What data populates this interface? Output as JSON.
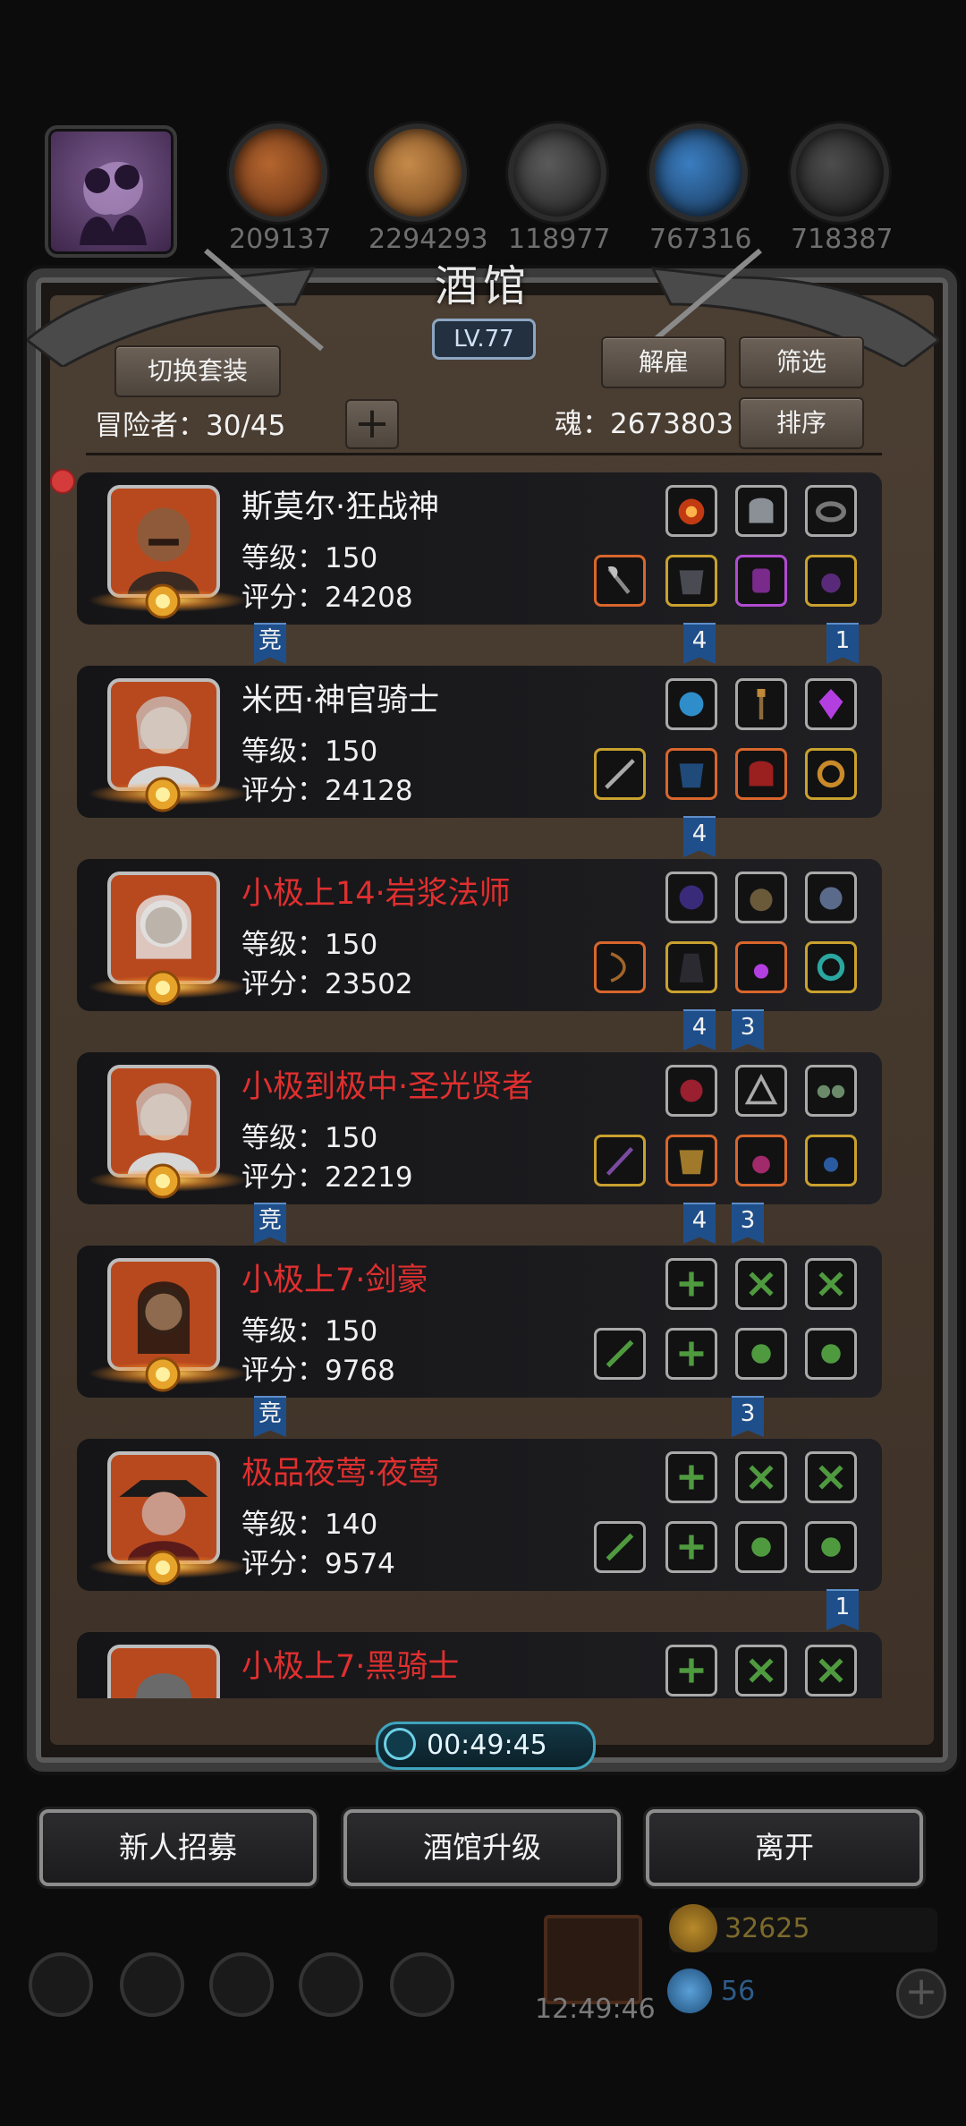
{
  "top_resources": [
    {
      "id": "wood",
      "value": "209137"
    },
    {
      "id": "plank",
      "value": "2294293"
    },
    {
      "id": "stone",
      "value": "118977"
    },
    {
      "id": "crystal",
      "value": "767316"
    },
    {
      "id": "iron",
      "value": "718387"
    }
  ],
  "panel": {
    "title": "酒馆",
    "level": "LV.77",
    "switch_outfit": "切换套装",
    "dismiss": "解雇",
    "filter": "筛选",
    "sort": "排序",
    "adventurers_label": "冒险者：30/45",
    "soul_label": "魂：2673803"
  },
  "heroes": [
    {
      "name": "斯莫尔·狂战神",
      "name_red": false,
      "level": "等级：150",
      "score": "评分：24208",
      "avatar_color": "#b8491e"
    },
    {
      "name": "米西·神官骑士",
      "name_red": false,
      "level": "等级：150",
      "score": "评分：24128",
      "avatar_color": "#b8491e"
    },
    {
      "name": "小极上14·岩浆法师",
      "name_red": true,
      "level": "等级：150",
      "score": "评分：23502",
      "avatar_color": "#b8491e"
    },
    {
      "name": "小极到极中·圣光贤者",
      "name_red": true,
      "level": "等级：150",
      "score": "评分：22219",
      "avatar_color": "#b8491e"
    },
    {
      "name": "小极上7·剑豪",
      "name_red": true,
      "level": "等级：150",
      "score": "评分：9768",
      "avatar_color": "#b8491e"
    },
    {
      "name": "极品夜莺·夜莺",
      "name_red": true,
      "level": "等级：140",
      "score": "评分：9574",
      "avatar_color": "#b8491e"
    },
    {
      "name": "小极上7·黑骑士",
      "name_red": true,
      "level": "",
      "score": "",
      "avatar_color": "#b8491e"
    }
  ],
  "tags": {
    "jing": "竞",
    "n4": "4",
    "n3": "3",
    "n1": "1"
  },
  "timer": "00:49:45",
  "bottom_buttons": {
    "recruit": "新人招募",
    "upgrade": "酒馆升级",
    "leave": "离开"
  },
  "dock": {
    "time": "12:49:46",
    "gold": "32625",
    "gems": "56"
  },
  "colors": {
    "name_red": "#e02f2f",
    "tag_blue": "#1f4f8a",
    "frame_brown": "#4b3e32"
  }
}
